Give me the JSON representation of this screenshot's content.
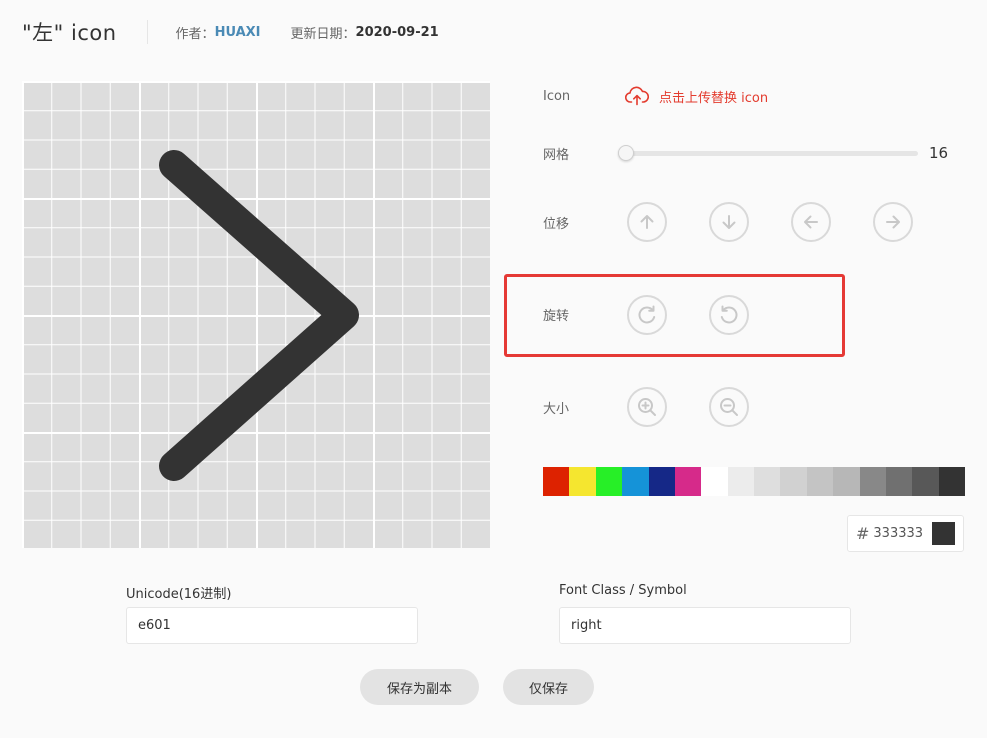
{
  "header": {
    "title": "\"左\" icon",
    "author_label": "作者：",
    "author": "HUAXI",
    "date_label": "更新日期：",
    "date": "2020-09-21"
  },
  "canvas": {
    "grid_label": "16",
    "icon_color": "#333333",
    "glyph": "chevron-right"
  },
  "controls": {
    "icon_label": "Icon",
    "upload_label": "点击上传替换 icon",
    "grid_label": "网格",
    "grid_value": "16",
    "grid_fraction": 0.0,
    "move_label": "位移",
    "rotate_label": "旋转",
    "size_label": "大小"
  },
  "palette": [
    "#dd2200",
    "#f5e62f",
    "#27ef27",
    "#1593d8",
    "#152887",
    "#d62a8a",
    "#ffffff",
    "#ececec",
    "#dedede",
    "#d1d1d1",
    "#c4c4c4",
    "#b7b7b7",
    "#888888",
    "#707070",
    "#585858",
    "#333333"
  ],
  "color_input": {
    "hash": "#",
    "value": "333333",
    "preview": "#333333"
  },
  "fields": {
    "unicode_label": "Unicode(16进制)",
    "unicode_value": "e601",
    "fontclass_label": "Font Class / Symbol",
    "fontclass_value": "right"
  },
  "actions": {
    "save_copy": "保存为副本",
    "save_only": "仅保存"
  },
  "colors": {
    "accent": "#e33b2e",
    "highlight": "#e53935",
    "author": "#4a8ab5"
  }
}
